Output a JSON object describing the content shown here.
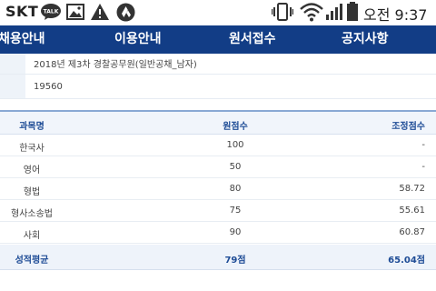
{
  "status_bar": {
    "carrier": "SKT",
    "talk_badge": "TALK",
    "time": "오전 9:37",
    "icons": [
      "kakaotalk-icon",
      "photo-icon",
      "warning-icon",
      "drive-icon",
      "vibrate-icon",
      "wifi-icon",
      "signal-icon",
      "battery-icon"
    ]
  },
  "nav": {
    "items": [
      {
        "label": "채용안내"
      },
      {
        "label": "이용안내"
      },
      {
        "label": "원서접수"
      },
      {
        "label": "공지사항"
      }
    ]
  },
  "info": {
    "exam_name": "2018년 제3차 경찰공무원(일반공채_남자)",
    "exam_number": "19560"
  },
  "score_table": {
    "headers": {
      "subject": "과목명",
      "raw": "원점수",
      "adjusted": "조정점수"
    },
    "rows": [
      {
        "subject": "한국사",
        "raw": "100",
        "adjusted": "-"
      },
      {
        "subject": "영어",
        "raw": "50",
        "adjusted": "-"
      },
      {
        "subject": "형법",
        "raw": "80",
        "adjusted": "58.72"
      },
      {
        "subject": "형사소송법",
        "raw": "75",
        "adjusted": "55.61"
      },
      {
        "subject": "사회",
        "raw": "90",
        "adjusted": "60.87"
      }
    ],
    "footer": {
      "label": "성적평균",
      "raw": "79점",
      "adjusted": "65.04점"
    }
  },
  "colors": {
    "nav_bg": "#123d86",
    "header_text": "#1e4c96",
    "header_bg": "#f1f5fb"
  }
}
